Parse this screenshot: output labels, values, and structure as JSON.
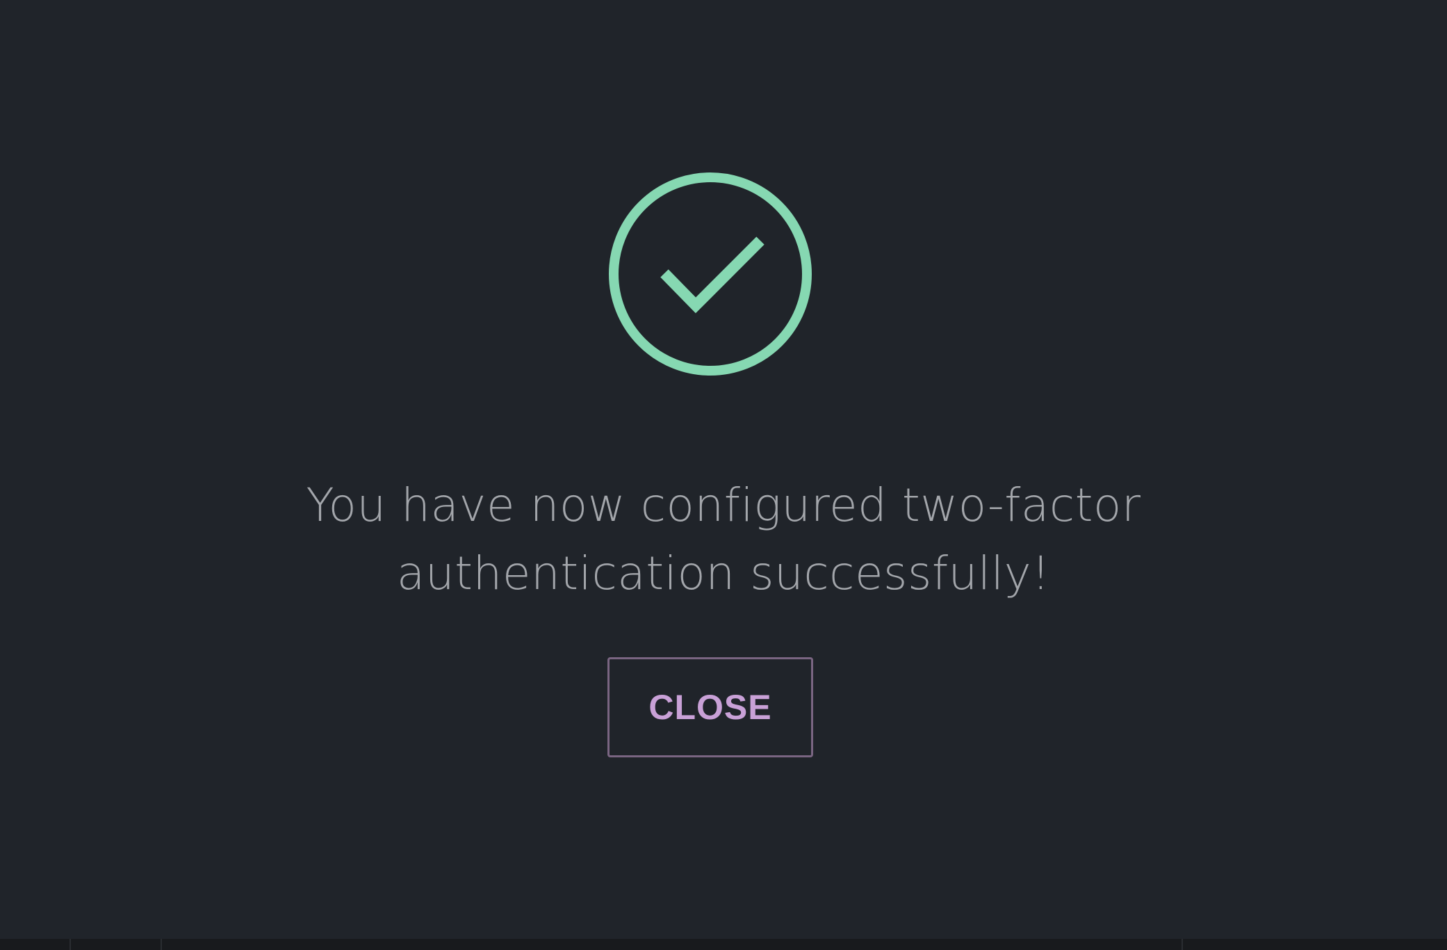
{
  "success_dialog": {
    "icon": "check-circle-icon",
    "message": "You have now configured two-factor authentication successfully!",
    "close_label": "CLOSE"
  },
  "colors": {
    "background": "#20242a",
    "success": "#86d8b2",
    "message_text": "#a3a6ab",
    "button_text": "#c9a1d7",
    "button_border": "#7a6582"
  }
}
